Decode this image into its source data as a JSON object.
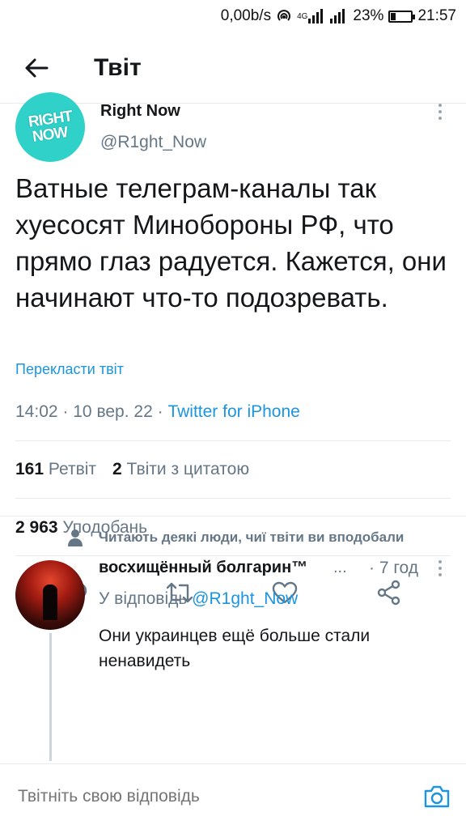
{
  "status_bar": {
    "network_speed": "0,00b/s",
    "network_type": "4G",
    "battery_percent": "23%",
    "battery_level": 0.23,
    "time": "21:57",
    "icons": [
      "hotspot-icon",
      "signal-icon",
      "battery-icon"
    ]
  },
  "header": {
    "title": "Твіт",
    "back_icon": "arrow-left-icon"
  },
  "tweet": {
    "avatar_text_line1": "RIGHT",
    "avatar_text_line2": "NOW",
    "author_name": "Right Now",
    "author_handle": "@R1ght_Now",
    "text": "Ватные телеграм-каналы так хуесосят Минобороны РФ, что прямо глаз радуется. Кажется, они начинают что-то подозревать.",
    "translate_label": "Перекласти твіт",
    "time": "14:02",
    "date": "10 вер. 22",
    "separator": "·",
    "source": "Twitter for iPhone",
    "retweets_count": "161",
    "retweets_label": "Ретвіт",
    "quotes_count": "2",
    "quotes_label": "Твіти з цитатою",
    "likes_count": "2 963",
    "likes_label": "Уподобань",
    "actions": [
      "reply-icon",
      "retweet-icon",
      "like-icon",
      "share-icon"
    ]
  },
  "reply_section": {
    "context_text": "Читають деякі люди, чиї твіти ви вподобали",
    "reply": {
      "author_name": "восхищённый болгарин™",
      "ellipsis": "...",
      "time": "· 7 год",
      "replying_prefix": "У відповідь",
      "replying_handle": "@R1ght_Now",
      "text": "Они украинцев ещё больше стали ненавидеть"
    }
  },
  "compose": {
    "placeholder": "Твітніть свою відповідь",
    "camera_icon": "camera-icon"
  },
  "colors": {
    "accent": "#1b95e0",
    "secondary_text": "#657786",
    "primary_text": "#14171a",
    "divider": "#e6ecf0"
  }
}
